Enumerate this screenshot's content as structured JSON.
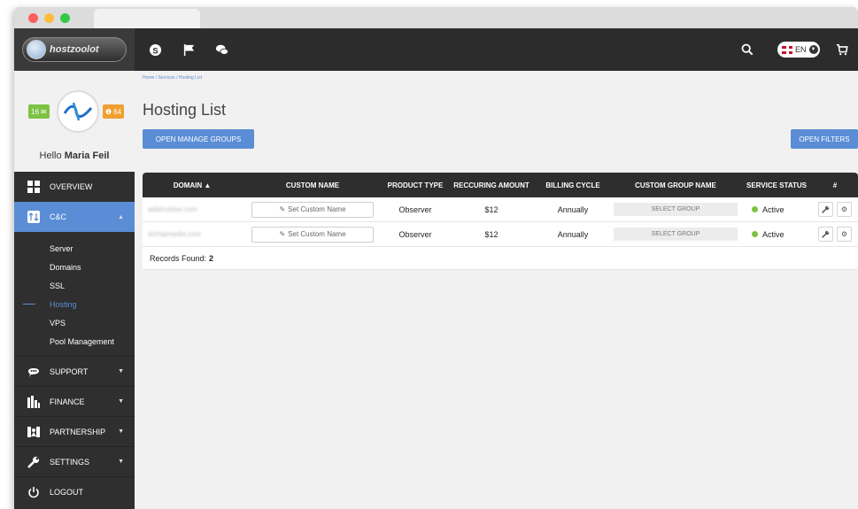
{
  "header": {
    "logo_text": "hostzoolot",
    "icons": [
      "skype-icon",
      "flag-icon",
      "chat-icon",
      "search-icon",
      "cart-icon"
    ],
    "language": "EN"
  },
  "sidebar": {
    "profile": {
      "greeting": "Hello",
      "user_name": "Maria Feil",
      "messages_count": "16",
      "alerts_count": "64"
    },
    "items": [
      {
        "label": "OVERVIEW",
        "icon": "grid-icon"
      },
      {
        "label": "C&C",
        "icon": "swap-icon",
        "active": true
      },
      {
        "label": "SUPPORT",
        "icon": "chat-bubble-icon"
      },
      {
        "label": "FINANCE",
        "icon": "finance-icon"
      },
      {
        "label": "PARTNERSHIP",
        "icon": "partnership-icon"
      },
      {
        "label": "SETTINGS",
        "icon": "wrench-icon"
      },
      {
        "label": "LOGOUT",
        "icon": "power-icon"
      }
    ],
    "submenu": [
      "Server",
      "Domains",
      "SSL",
      "Hosting",
      "VPS",
      "Pool Management"
    ]
  },
  "main": {
    "breadcrumb": "Home / Services / Hosting List",
    "title": "Hosting List",
    "manage_groups_button": "OPEN MANAGE GROUPS",
    "filters_button": "OPEN FILTERS",
    "table": {
      "columns": [
        "DOMAIN ▲",
        "CUSTOM NAME",
        "PRODUCT TYPE",
        "RECCURING AMOUNT",
        "BILLING CYCLE",
        "CUSTOM GROUP NAME",
        "SERVICE STATUS",
        "#"
      ],
      "rows": [
        {
          "domain": "adidrostive.com",
          "custom_name": "Set Custom Name",
          "product_type": "Observer",
          "amount": "$12",
          "cycle": "Annually",
          "group": "SELECT GROUP",
          "status": "Active"
        },
        {
          "domain": "elchipmedia.com",
          "custom_name": "Set Custom Name",
          "product_type": "Observer",
          "amount": "$12",
          "cycle": "Annually",
          "group": "SELECT GROUP",
          "status": "Active"
        }
      ],
      "records_label": "Records Found:",
      "records_count": "2"
    }
  },
  "colors": {
    "accent": "#5b8dd6",
    "topbar": "#2c2c2c",
    "sidebar": "#2f2f2f",
    "status_active": "#7dc242"
  }
}
